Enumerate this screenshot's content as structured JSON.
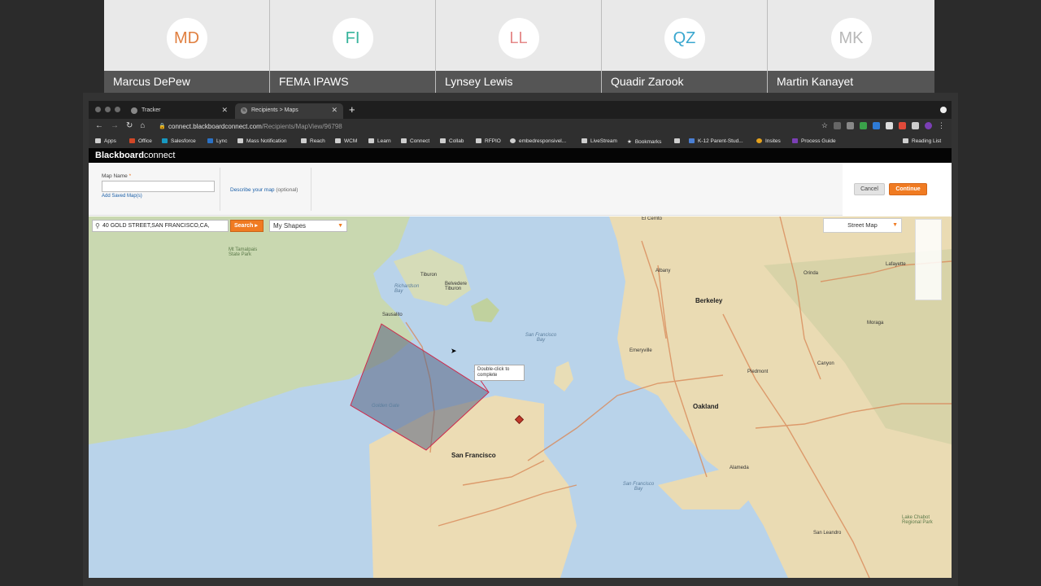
{
  "participants": [
    {
      "initials": "MD",
      "name": "Marcus DePew",
      "color": "#e07f3f"
    },
    {
      "initials": "FI",
      "name": "FEMA IPAWS",
      "color": "#37b49c"
    },
    {
      "initials": "LL",
      "name": "Lynsey Lewis",
      "color": "#e58a8a"
    },
    {
      "initials": "QZ",
      "name": "Quadir Zarook",
      "color": "#3aa7cf"
    },
    {
      "initials": "MK",
      "name": "Martin Kanayet",
      "color": "#b8b8b8"
    }
  ],
  "browser": {
    "tabs": [
      {
        "label": "Tracker"
      },
      {
        "label": "Recipients > Maps"
      }
    ],
    "url_host": "connect.blackboardconnect.com",
    "url_path": "/Recipients/MapView/96798",
    "bookmarks": [
      "Apps",
      "Office",
      "Salesforce",
      "Lync",
      "Mass Notification",
      "Reach",
      "WCM",
      "Learn",
      "Connect",
      "Collab",
      "RFPIO",
      "embedresponsivel...",
      "LiveStream",
      "Bookmarks",
      "",
      "K-12 Parent-Stud...",
      "Insites",
      "Process Guide"
    ],
    "reading_list": "Reading List"
  },
  "app": {
    "brand_bold": "Blackboard",
    "brand_light": "connect"
  },
  "form": {
    "map_name_label": "Map Name",
    "required_mark": "*",
    "map_name_value": "",
    "add_saved_maps": "Add Saved Map(s)",
    "describe_link": "Describe your map",
    "describe_optional": "(optional)",
    "cancel_label": "Cancel",
    "continue_label": "Continue"
  },
  "map": {
    "search_value": "40 GOLD STREET,SAN FRANCISCO,CA,",
    "search_button": "Search",
    "shapes_dropdown": "My Shapes",
    "basemap_dropdown": "Street Map",
    "tooltip": "Double-click to complete",
    "labels": {
      "el_cerrito": "El Cerrito",
      "albany": "Albany",
      "berkeley": "Berkeley",
      "orinda": "Orinda",
      "lafayette": "Lafayette",
      "moraga": "Moraga",
      "emeryville": "Emeryville",
      "piedmont": "Piedmont",
      "canyon": "Canyon",
      "oakland": "Oakland",
      "alameda": "Alameda",
      "san_francisco": "San Francisco",
      "sf_bay": "San Francisco Bay",
      "sf_bay_south": "San Francisco Bay",
      "san_leandro": "San Leandro",
      "tiburon": "Tiburon",
      "belvedere": "Belvedere Tiburon",
      "sausalito": "Sausalito",
      "richardson_bay": "Richardson Bay",
      "golden_gate": "Golden Gate",
      "tamalpais": "Mt Tamalpais State Park",
      "lake_chabot": "Lake Chabot Regional Park"
    }
  }
}
